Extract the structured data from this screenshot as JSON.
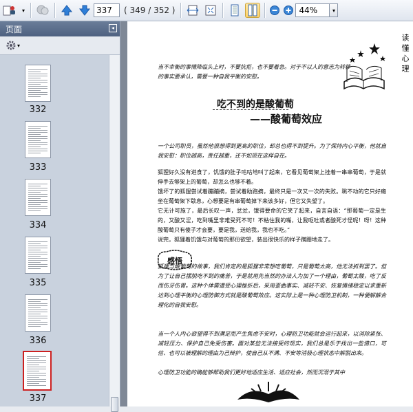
{
  "toolbar": {
    "current_page": "337",
    "page_total": "( 349 / 352 )",
    "zoom": "44%"
  },
  "sidebar": {
    "panel_title": "页面",
    "thumbnails": [
      {
        "label": "332",
        "selected": false
      },
      {
        "label": "333",
        "selected": false
      },
      {
        "label": "334",
        "selected": false
      },
      {
        "label": "335",
        "selected": false
      },
      {
        "label": "336",
        "selected": false
      },
      {
        "label": "337",
        "selected": true
      }
    ]
  },
  "document": {
    "running_header": "读懂心理",
    "quote": "当不幸衡的事情降临头上时，不要抗拒，也不要着急。对于不以人的意志为转移的事实要承认，需要一种自我平衡的安慰。",
    "title": "吃不到的是酸葡萄",
    "subtitle": "——酸葡萄效应",
    "intro": "一个公司职员，虽然他很想得到更高的职位，却总也得不到提升。为了保持内心平衡，他就自我安慰：职位越高，责任越重，还不如现在这样自在。",
    "paragraphs": [
      "狐狸好久没有进食了，饥饿的肚子咕咕地叫了起来，它看见葡萄架上挂着一串串葡萄，于是就伸手去够架上的葡萄，却怎么也够不着。",
      "饿坏了的狐狸尝试着蹦蹦摘，尝试着助跑摘，最终只是一次又一次的失败。跳不动的它只好瘫坐在葡萄架下歇息，心想要是有串葡萄掉下来该多好，但它又失望了。",
      "它无计可施了，最后长叹一声，忿忿，饿得要命的它笑了起来，自言自语：“那葡萄一定是生的，又酸又涩，吃到嘴里非难受死不可！不粘住我的嘴，让我呕吐或者酸死才怪呢！呀！这种酸葡萄只有傻子才会要，要是我，送给我，我也不吃。”",
      "说完，狐狸着饥饿与对葡萄的那份欲望，装出很快乐的样子蹒跚地走了。"
    ],
    "ganwu_label": "感悟",
    "reflection": [
      "狐狸与酸葡萄的故事，我们肯定的是狐狸非常想吃葡萄，只是葡萄太高，他无法抓到罢了。但为了让自己摆脱吃不到的痛苦，于是就用先当然的办法人为加了一个理由，葡萄太酸，吃了反而伤牙伤胃。这种个体需遭受心理挫折后，采用歪曲事实、减轻不安、恢复情绪稳定以求重新达到心理平衡的心理防御方式就是酸葡萄效应。这实际上是一种心理防卫机制，一种便解解合理化的自我安慰。",
      "当一个人内心欲望得不到满足而产生焦虑不安时，心理防卫功能就会运行起来，以消除紧张、减轻压力、保护自己免受伤害。面对某些无法接受的现实，我们总是乐于找出一些借口，可信、也可以被理解的理由为己辩护，使自己从不满、不安等消极心理状态中解脱出来。",
      "心理防卫功能的确能够帮助我们更好地适应生活、适应社会，然而沉溺于其中"
    ]
  }
}
